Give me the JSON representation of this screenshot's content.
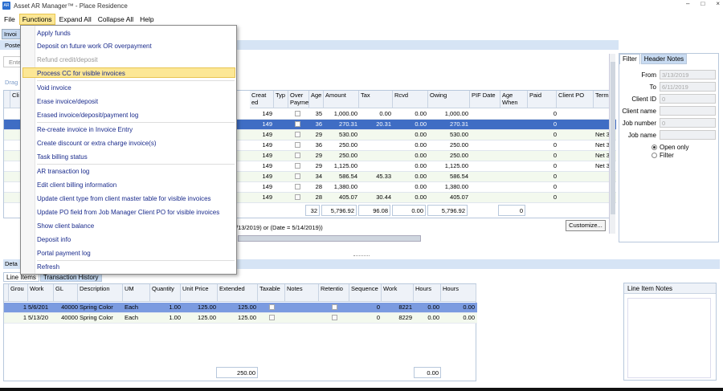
{
  "window": {
    "title": "Asset AR Manager™ - Place Residence",
    "icon": "app-icon",
    "min": "–",
    "max": "□",
    "close": "×"
  },
  "menubar": {
    "items": [
      "File",
      "Functions",
      "Expand All",
      "Collapse All",
      "Help"
    ]
  },
  "left_tabs": {
    "invoices": "Invoi",
    "post": "Poste",
    "enter": "Ente",
    "drag": "Drag",
    "client": "Cli",
    "detail": "Deta"
  },
  "functions_menu": {
    "items": [
      "Apply funds",
      "Deposit on future work OR overpayment",
      "Refund credit/deposit",
      "Process CC for visible invoices",
      "Void invoice",
      "Erase invoice/deposit",
      "Erased invoice/deposit/payment log",
      "Re-create invoice in Invoice Entry",
      "Create discount or extra charge invoice(s)",
      "Task billing status",
      "AR transaction log",
      "Edit client billing information",
      "Update client type from client master table for visible invoices",
      "Update PO field from Job Manager Client PO for visible invoices",
      "Show client balance",
      "Deposit info",
      "Portal payment log",
      "Refresh"
    ],
    "highlighted": "Process CC for visible invoices",
    "disabled": "Refund credit/deposit"
  },
  "invoice_grid": {
    "headers": [
      "Creat ed",
      "Typ",
      "Over Payme",
      "Age",
      "Amount",
      "Tax",
      "Rcvd",
      "Owing",
      "PIF Date",
      "Age When",
      "Paid",
      "Client PO",
      "Terms"
    ],
    "rows": [
      {
        "created": "149",
        "age": "35",
        "amount": "1,000.00",
        "tax": "0.00",
        "rcvd": "0.00",
        "owing": "1,000.00",
        "paid": "0",
        "terms": ""
      },
      {
        "created": "149",
        "age": "36",
        "amount": "270.31",
        "tax": "20.31",
        "rcvd": "0.00",
        "owing": "270.31",
        "paid": "0",
        "terms": ""
      },
      {
        "created": "149",
        "age": "29",
        "amount": "530.00",
        "tax": "",
        "rcvd": "0.00",
        "owing": "530.00",
        "paid": "0",
        "terms": "Net 3"
      },
      {
        "created": "149",
        "age": "36",
        "amount": "250.00",
        "tax": "",
        "rcvd": "0.00",
        "owing": "250.00",
        "paid": "0",
        "terms": "Net 3"
      },
      {
        "created": "149",
        "age": "29",
        "amount": "250.00",
        "tax": "",
        "rcvd": "0.00",
        "owing": "250.00",
        "paid": "0",
        "terms": "Net 3"
      },
      {
        "created": "149",
        "age": "29",
        "amount": "1,125.00",
        "tax": "",
        "rcvd": "0.00",
        "owing": "1,125.00",
        "paid": "0",
        "terms": "Net 3"
      },
      {
        "created": "149",
        "age": "34",
        "amount": "586.54",
        "tax": "45.33",
        "rcvd": "0.00",
        "owing": "586.54",
        "paid": "0",
        "terms": ""
      },
      {
        "created": "149",
        "age": "28",
        "amount": "1,380.00",
        "tax": "",
        "rcvd": "0.00",
        "owing": "1,380.00",
        "paid": "0",
        "terms": ""
      },
      {
        "created": "149",
        "age": "28",
        "amount": "405.07",
        "tax": "30.44",
        "rcvd": "0.00",
        "owing": "405.07",
        "paid": "0",
        "terms": ""
      }
    ],
    "totals": {
      "age": "32",
      "amount": "5,796.92",
      "tax": "96.08",
      "rcvd": "0.00",
      "owing": "5,796.92",
      "paid": "0"
    }
  },
  "filter_text": "/13/2019) or (Date = 5/14/2019))",
  "customize_label": "Customize...",
  "right_panel": {
    "tabs": [
      "Filter",
      "Header Notes"
    ],
    "from_label": "From",
    "from_value": "3/13/2019",
    "to_label": "To",
    "to_value": "6/11/2019",
    "client_id_label": "Client ID",
    "client_id_value": "0",
    "client_name_label": "Client name",
    "job_number_label": "Job number",
    "job_number_value": "0",
    "job_name_label": "Job name",
    "radio_open": "Open only",
    "radio_filter": "Filter"
  },
  "detail": {
    "subtabs": [
      "Line Items",
      "Transaction History"
    ],
    "headers": [
      "Grou",
      "Work",
      "GL",
      "Description",
      "UM",
      "Quantity",
      "Unit Price",
      "Extended",
      "Taxable",
      "Notes",
      "Retentio",
      "Sequence",
      "Work",
      "Hours",
      "Hours"
    ],
    "rows": [
      {
        "group": "1",
        "work": "5/6/201",
        "gl": "40000",
        "desc": "Spring Color",
        "um": "Each",
        "qty": "1.00",
        "price": "125.00",
        "ext": "125.00",
        "seq": "0",
        "work2": "8221",
        "hours": "0.00",
        "hours2": "0.00"
      },
      {
        "group": "1",
        "work": "5/13/20",
        "gl": "40000",
        "desc": "Spring Color",
        "um": "Each",
        "qty": "1.00",
        "price": "125.00",
        "ext": "125.00",
        "seq": "0",
        "work2": "8229",
        "hours": "0.00",
        "hours2": "0.00"
      }
    ],
    "total_extended": "250.00",
    "total_hours": "0.00",
    "notes_title": "Line Item Notes"
  }
}
